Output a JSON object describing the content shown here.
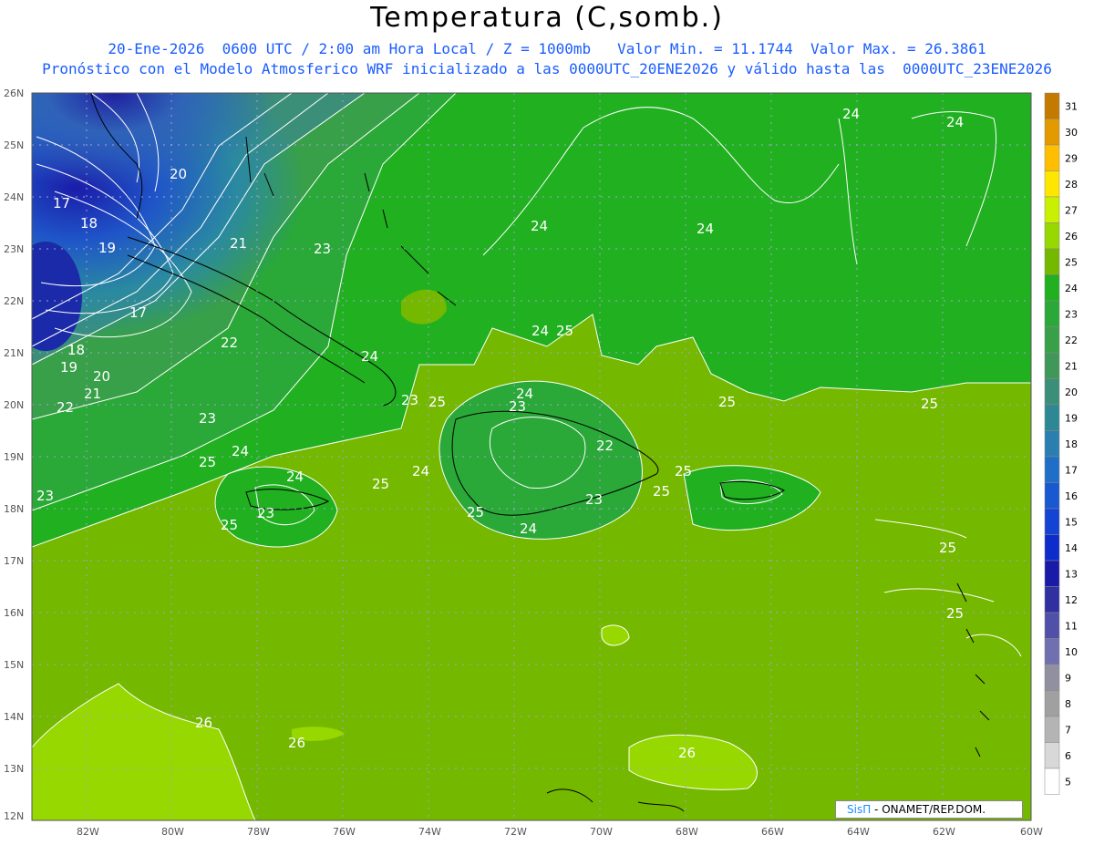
{
  "title": "Temperatura (C,somb.)",
  "subtitle_line1": "20-Ene-2026  0600 UTC / 2:00 am Hora Local / Z = 1000mb   Valor Min. = 11.1744  Valor Max. = 26.3861",
  "subtitle_line2": "Pronóstico con el Modelo Atmosferico WRF inicializado a las 0000UTC_20ENE2026 y válido hasta las  0000UTC_23ENE2026",
  "lat_labels": [
    "26N",
    "25N",
    "24N",
    "23N",
    "22N",
    "21N",
    "20N",
    "19N",
    "18N",
    "17N",
    "16N",
    "15N",
    "14N",
    "13N",
    "12N"
  ],
  "lon_labels": [
    "82W",
    "80W",
    "78W",
    "76W",
    "74W",
    "72W",
    "70W",
    "68W",
    "66W",
    "64W",
    "62W",
    "60W"
  ],
  "colorbar": {
    "levels": [
      "31",
      "30",
      "29",
      "28",
      "27",
      "26",
      "25",
      "24",
      "23",
      "22",
      "21",
      "20",
      "19",
      "18",
      "17",
      "16",
      "15",
      "14",
      "13",
      "12",
      "11",
      "10",
      "9",
      "8",
      "7",
      "6",
      "5"
    ],
    "colors": [
      "#c47a00",
      "#e39a00",
      "#ffbf00",
      "#ffe600",
      "#c8f000",
      "#96d800",
      "#74b800",
      "#20b020",
      "#2aa838",
      "#38a048",
      "#409858",
      "#3b8f78",
      "#2e8894",
      "#2a7fb0",
      "#1f6fc8",
      "#1858d0",
      "#1444d4",
      "#0c2ccc",
      "#1a1aa8",
      "#3030a0",
      "#5050a8",
      "#7070b0",
      "#9090a0",
      "#a0a0a0",
      "#b4b4b4",
      "#d8d8d8",
      "#ffffff"
    ]
  },
  "contour_labels": [
    "17",
    "18",
    "19",
    "20",
    "21",
    "22",
    "23",
    "24",
    "25",
    "26"
  ],
  "credit": {
    "brand": "SisΠ",
    "text": " - ONAMET/REP.DOM."
  },
  "colors": {
    "subtitle": "#1a5cff",
    "credit_brand": "#1a8cff"
  }
}
